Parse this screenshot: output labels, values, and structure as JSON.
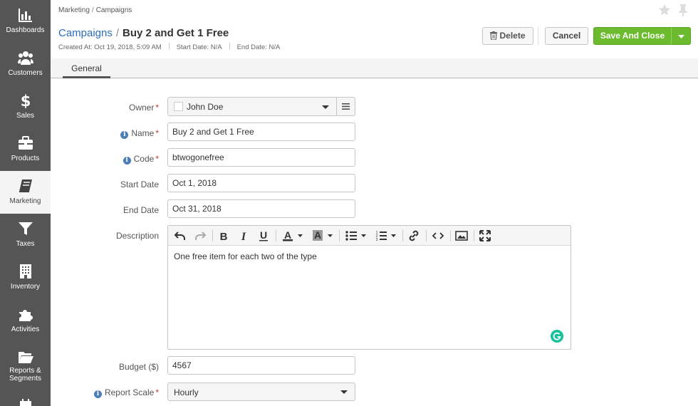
{
  "sidebar": {
    "items": [
      {
        "label": "Dashboards",
        "icon": "bar-chart-icon",
        "active": false
      },
      {
        "label": "Customers",
        "icon": "users-icon",
        "active": false
      },
      {
        "label": "Sales",
        "icon": "dollar-icon",
        "active": false
      },
      {
        "label": "Products",
        "icon": "briefcase-icon",
        "active": false
      },
      {
        "label": "Marketing",
        "icon": "book-icon",
        "active": true
      },
      {
        "label": "Taxes",
        "icon": "funnel-icon",
        "active": false
      },
      {
        "label": "Inventory",
        "icon": "building-icon",
        "active": false
      },
      {
        "label": "Activities",
        "icon": "puzzle-icon",
        "active": false
      },
      {
        "label_line1": "Reports &",
        "label_line2": "Segments",
        "icon": "folder-icon",
        "active": false
      }
    ]
  },
  "header": {
    "breadcrumb": [
      "Marketing",
      "Campaigns"
    ],
    "breadcrumb_sep": "/",
    "title_crumb": "Campaigns",
    "title_sep": "/",
    "title_name": "Buy 2 and Get 1 Free",
    "meta": {
      "created": "Created At: Oct 19, 2018, 5:09 AM",
      "start": "Start Date: N/A",
      "end": "End Date: N/A"
    },
    "buttons": {
      "delete": "Delete",
      "cancel": "Cancel",
      "save_and_close": "Save And Close"
    }
  },
  "tabs": {
    "general": "General"
  },
  "form": {
    "owner": {
      "label": "Owner",
      "required": "*",
      "value": "John Doe"
    },
    "name": {
      "label": "Name",
      "required": "*",
      "value": "Buy 2 and Get 1 Free"
    },
    "code": {
      "label": "Code",
      "required": "*",
      "value": "btwogonefree"
    },
    "start_date": {
      "label": "Start Date",
      "value": "Oct 1, 2018"
    },
    "end_date": {
      "label": "End Date",
      "value": "Oct 31, 2018"
    },
    "description": {
      "label": "Description",
      "value": "One free item for each two of the type"
    },
    "budget": {
      "label": "Budget ($)",
      "value": "4567"
    },
    "report_scale": {
      "label": "Report Scale",
      "required": "*",
      "value": "Hourly"
    }
  },
  "colors": {
    "sidebar_bg": "#555555",
    "accent_link": "#2a6ebb",
    "save_green": "#6cbb2e",
    "required_red": "#c0392b",
    "info_blue": "#4b7fb5",
    "grammarly_green": "#15c39a"
  }
}
